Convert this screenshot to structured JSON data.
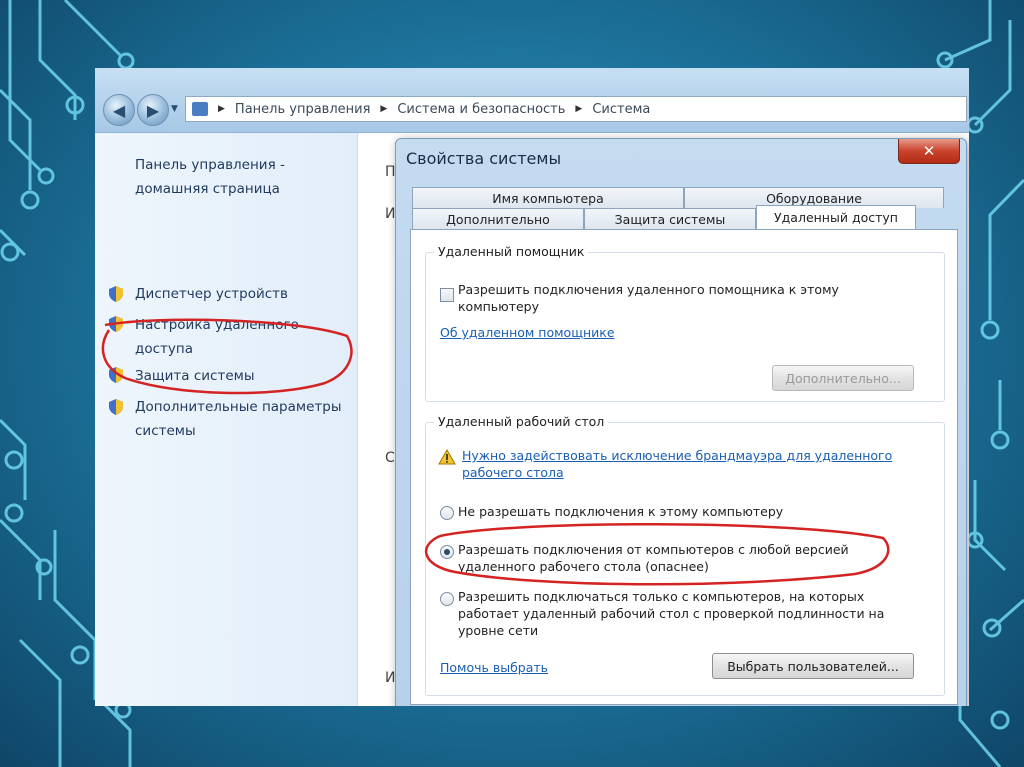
{
  "breadcrumb": [
    "Панель управления",
    "Система и безопасность",
    "Система"
  ],
  "left_pane": {
    "home_link": "Панель управления - домашняя страница",
    "items": [
      {
        "label": "Диспетчер устройств",
        "icon": "shield-icon"
      },
      {
        "label": "Настройка удаленного доступа",
        "icon": "shield-icon"
      },
      {
        "label": "Защита системы",
        "icon": "shield-icon"
      },
      {
        "label": "Дополнительные параметры системы",
        "icon": "shield-icon"
      }
    ]
  },
  "behind": {
    "letters": [
      "П",
      "И",
      "С",
      "И"
    ]
  },
  "dialog": {
    "title": "Свойства системы",
    "close_label": "✕",
    "tabs_top": [
      "Имя компьютера",
      "Оборудование"
    ],
    "tabs_bottom": [
      "Дополнительно",
      "Защита системы",
      "Удаленный доступ"
    ],
    "remote_assistance": {
      "title": "Удаленный помощник",
      "checkbox_label": "Разрешить подключения удаленного помощника к этому компьютеру",
      "link": "Об удаленном помощнике",
      "advanced_button": "Дополнительно..."
    },
    "remote_desktop": {
      "title": "Удаленный рабочий стол",
      "warning_link": "Нужно задействовать исключение брандмауэра для удаленного рабочего стола",
      "options": [
        "Не разрешать подключения к этому компьютеру",
        "Разрешать подключения от компьютеров с любой версией удаленного рабочего стола (опаснее)",
        "Разрешить подключаться только с компьютеров, на которых работает удаленный рабочий стол с проверкой подлинности на уровне сети"
      ],
      "selected_option": 1,
      "help_link": "Помочь выбрать",
      "select_users_button": "Выбрать пользователей..."
    }
  },
  "colors": {
    "annotation": "#d42323",
    "link": "#1a5fb4",
    "background": "#1b6f97"
  }
}
